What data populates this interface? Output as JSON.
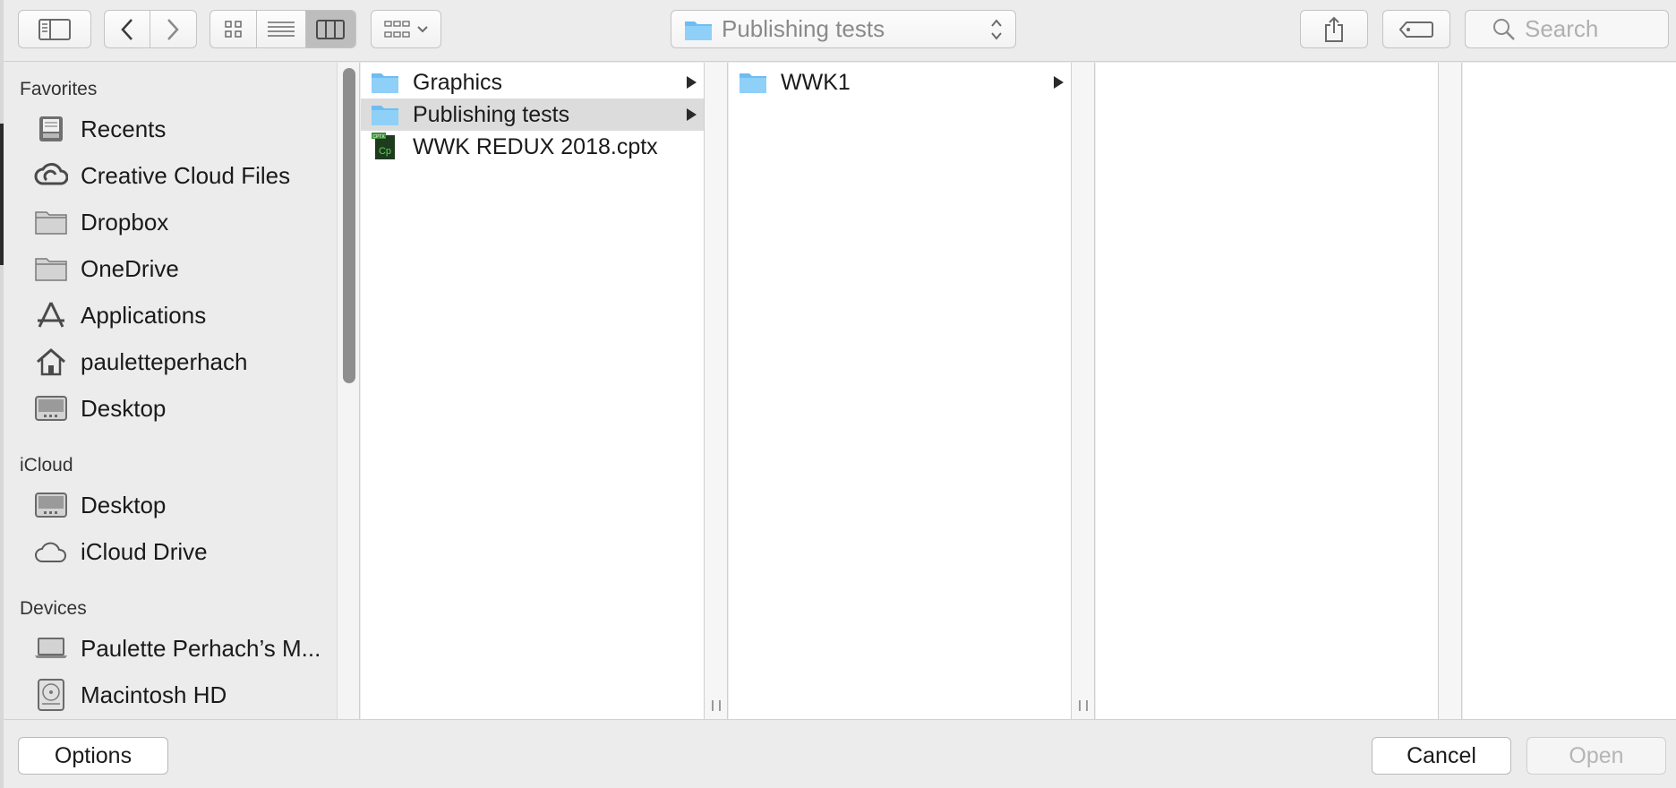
{
  "toolbar": {
    "path_label": "Publishing tests",
    "search_placeholder": "Search"
  },
  "sidebar": {
    "sections": [
      {
        "title": "Favorites",
        "items": [
          {
            "label": "Recents",
            "icon": "recents-icon"
          },
          {
            "label": "Creative Cloud Files",
            "icon": "creative-cloud-icon"
          },
          {
            "label": "Dropbox",
            "icon": "folder-icon"
          },
          {
            "label": "OneDrive",
            "icon": "folder-icon"
          },
          {
            "label": "Applications",
            "icon": "applications-icon"
          },
          {
            "label": "pauletteperhach",
            "icon": "home-icon"
          },
          {
            "label": "Desktop",
            "icon": "desktop-icon"
          }
        ]
      },
      {
        "title": "iCloud",
        "items": [
          {
            "label": "Desktop",
            "icon": "desktop-icon"
          },
          {
            "label": "iCloud Drive",
            "icon": "cloud-icon"
          }
        ]
      },
      {
        "title": "Devices",
        "items": [
          {
            "label": "Paulette Perhach’s M...",
            "icon": "laptop-icon"
          },
          {
            "label": "Macintosh HD",
            "icon": "hard-drive-icon"
          }
        ]
      }
    ]
  },
  "columns": [
    {
      "rows": [
        {
          "label": "Graphics",
          "icon": "folder-icon",
          "has_children": true,
          "selected": false
        },
        {
          "label": "Publishing tests",
          "icon": "folder-icon",
          "has_children": true,
          "selected": true
        },
        {
          "label": "WWK REDUX 2018.cptx",
          "icon": "captivate-file-icon",
          "has_children": false,
          "selected": false
        }
      ]
    },
    {
      "rows": [
        {
          "label": "WWK1",
          "icon": "folder-icon",
          "has_children": true,
          "selected": false
        }
      ]
    }
  ],
  "footer": {
    "options_label": "Options",
    "cancel_label": "Cancel",
    "open_label": "Open"
  },
  "colors": {
    "folder_blue": "#6cbdf3",
    "selection_gray": "#dcdcdc",
    "captivate_green": "#3e8e3a"
  }
}
